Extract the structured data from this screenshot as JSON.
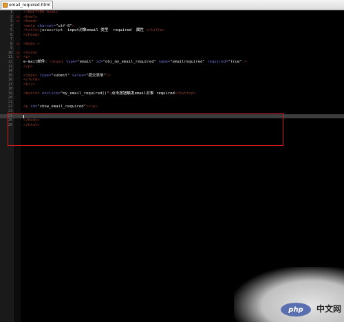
{
  "tab": {
    "filename": "email_required.html"
  },
  "watermark": {
    "logo": "php",
    "site": "中文网"
  },
  "code_lines": [
    {
      "n": "1",
      "fold": "",
      "segments": [
        {
          "c": "tag",
          "t": "<!DOCTYPE html>"
        }
      ]
    },
    {
      "n": "2",
      "fold": "⊟",
      "segments": [
        {
          "c": "tag",
          "t": "<html>"
        }
      ]
    },
    {
      "n": "3",
      "fold": "⊟",
      "segments": [
        {
          "c": "tag",
          "t": "<head>"
        }
      ]
    },
    {
      "n": "4",
      "fold": "",
      "segments": [
        {
          "c": "tag",
          "t": "<meta "
        },
        {
          "c": "attr",
          "t": "charset="
        },
        {
          "c": "str",
          "t": "\"utf-8\""
        },
        {
          "c": "tag",
          "t": ">"
        }
      ]
    },
    {
      "n": "5",
      "fold": "",
      "segments": [
        {
          "c": "tag",
          "t": "<title>"
        },
        {
          "c": "txt",
          "t": "javascript  "
        },
        {
          "c": "cn",
          "t": "input对象email 类型  required  属性 "
        },
        {
          "c": "tag",
          "t": "</title>"
        }
      ]
    },
    {
      "n": "6",
      "fold": "",
      "segments": [
        {
          "c": "tag",
          "t": "</head>"
        }
      ]
    },
    {
      "n": "7",
      "fold": "",
      "segments": []
    },
    {
      "n": "8",
      "fold": "⊟",
      "segments": [
        {
          "c": "tag",
          "t": "<body >"
        }
      ]
    },
    {
      "n": "9",
      "fold": "",
      "segments": []
    },
    {
      "n": "10",
      "fold": "⊟",
      "segments": [
        {
          "c": "tag",
          "t": "<form>"
        }
      ]
    },
    {
      "n": "11",
      "fold": "⊟",
      "segments": [
        {
          "c": "tag",
          "t": "<p>"
        }
      ]
    },
    {
      "n": "12",
      "fold": "",
      "segments": [
        {
          "c": "cn",
          "t": "e-mail邮件: "
        },
        {
          "c": "tag",
          "t": "<input "
        },
        {
          "c": "attr",
          "t": "type="
        },
        {
          "c": "str",
          "t": "\"email\" "
        },
        {
          "c": "attr",
          "t": "id="
        },
        {
          "c": "str",
          "t": "\"obj_my_email_required\" "
        },
        {
          "c": "attr",
          "t": "name="
        },
        {
          "c": "str",
          "t": "\"emailrequired\" "
        },
        {
          "c": "attr",
          "t": "required="
        },
        {
          "c": "str",
          "t": "\"true\" "
        },
        {
          "c": "tag",
          "t": ">"
        }
      ]
    },
    {
      "n": "13",
      "fold": "",
      "segments": [
        {
          "c": "tag",
          "t": "</p>"
        }
      ]
    },
    {
      "n": "14",
      "fold": "",
      "segments": []
    },
    {
      "n": "15",
      "fold": "",
      "segments": [
        {
          "c": "tag",
          "t": "<input "
        },
        {
          "c": "attr",
          "t": "type="
        },
        {
          "c": "str",
          "t": "\"submit\" "
        },
        {
          "c": "attr",
          "t": "value="
        },
        {
          "c": "str",
          "t": "\"提交表单\""
        },
        {
          "c": "tag",
          "t": "/>"
        }
      ]
    },
    {
      "n": "16",
      "fold": "",
      "segments": [
        {
          "c": "tag",
          "t": "</form>"
        }
      ]
    },
    {
      "n": "17",
      "fold": "",
      "segments": [
        {
          "c": "tag",
          "t": "<br/>"
        }
      ]
    },
    {
      "n": "18",
      "fold": "",
      "segments": []
    },
    {
      "n": "19",
      "fold": "",
      "segments": [
        {
          "c": "tag",
          "t": "<button "
        },
        {
          "c": "attr",
          "t": "onclick="
        },
        {
          "c": "str",
          "t": "\"my_email_required()\""
        },
        {
          "c": "tag",
          "t": ">"
        },
        {
          "c": "cn",
          "t": "点击按钮触发email对象 required"
        },
        {
          "c": "tag",
          "t": "</button>"
        }
      ]
    },
    {
      "n": "20",
      "fold": "",
      "segments": []
    },
    {
      "n": "21",
      "fold": "",
      "segments": []
    },
    {
      "n": "22",
      "fold": "",
      "segments": [
        {
          "c": "tag",
          "t": "<p "
        },
        {
          "c": "attr",
          "t": "id="
        },
        {
          "c": "str",
          "t": "\"show_email_required\""
        },
        {
          "c": "tag",
          "t": "></p>"
        }
      ]
    },
    {
      "n": "23",
      "fold": "",
      "segments": []
    },
    {
      "n": "24",
      "fold": "",
      "segments": [],
      "current": true
    },
    {
      "n": "25",
      "fold": "",
      "segments": [
        {
          "c": "tag",
          "t": "</body>"
        }
      ]
    },
    {
      "n": "26",
      "fold": "",
      "segments": [
        {
          "c": "tag",
          "t": "</html>"
        }
      ]
    }
  ]
}
